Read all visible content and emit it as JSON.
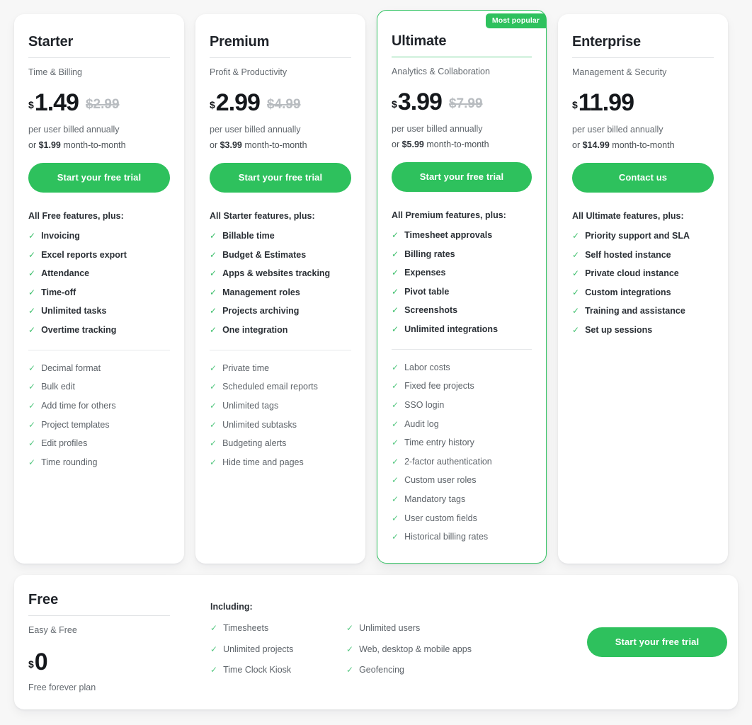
{
  "theme": {
    "accent": "#2ec15d",
    "tick": "#3cbf6b",
    "page_bg": "#f7f7f7",
    "card_bg": "#ffffff"
  },
  "plans": [
    {
      "name": "Starter",
      "tagline": "Time & Billing",
      "currency": "$",
      "price": "1.49",
      "old_price": "$2.99",
      "billing_note": "per user billed annually",
      "monthly_prefix": "or ",
      "monthly_price": "$1.99",
      "monthly_suffix": " month-to-month",
      "cta": "Start your free trial",
      "features_head": "All Free features, plus:",
      "primary_features": [
        "Invoicing",
        "Excel reports export",
        "Attendance",
        "Time-off",
        "Unlimited tasks",
        "Overtime tracking"
      ],
      "secondary_features": [
        "Decimal format",
        "Bulk edit",
        "Add time for others",
        "Project templates",
        "Edit profiles",
        "Time rounding"
      ]
    },
    {
      "name": "Premium",
      "tagline": "Profit & Productivity",
      "currency": "$",
      "price": "2.99",
      "old_price": "$4.99",
      "billing_note": "per user billed annually",
      "monthly_prefix": "or ",
      "monthly_price": "$3.99",
      "monthly_suffix": " month-to-month",
      "cta": "Start your free trial",
      "features_head": "All Starter features, plus:",
      "primary_features": [
        "Billable time",
        "Budget & Estimates",
        "Apps & websites tracking",
        "Management roles",
        "Projects archiving",
        "One integration"
      ],
      "secondary_features": [
        "Private time",
        "Scheduled email reports",
        "Unlimited tags",
        "Unlimited subtasks",
        "Budgeting alerts",
        "Hide time and pages"
      ]
    },
    {
      "name": "Ultimate",
      "badge": "Most popular",
      "tagline": "Analytics & Collaboration",
      "currency": "$",
      "price": "3.99",
      "old_price": "$7.99",
      "billing_note": "per user billed annually",
      "monthly_prefix": "or ",
      "monthly_price": "$5.99",
      "monthly_suffix": " month-to-month",
      "cta": "Start your free trial",
      "features_head": "All Premium features, plus:",
      "primary_features": [
        "Timesheet approvals",
        "Billing rates",
        "Expenses",
        "Pivot table",
        "Screenshots",
        "Unlimited integrations"
      ],
      "secondary_features": [
        "Labor costs",
        "Fixed fee projects",
        "SSO login",
        "Audit log",
        "Time entry history",
        "2-factor authentication",
        "Custom user roles",
        "Mandatory tags",
        "User custom fields",
        "Historical billing rates"
      ]
    },
    {
      "name": "Enterprise",
      "tagline": "Management & Security",
      "currency": "$",
      "price": "11.99",
      "old_price": "",
      "billing_note": "per user billed annually",
      "monthly_prefix": "or ",
      "monthly_price": "$14.99",
      "monthly_suffix": " month-to-month",
      "cta": "Contact us",
      "features_head": "All Ultimate features, plus:",
      "primary_features": [
        "Priority support and SLA",
        "Self hosted instance",
        "Private cloud instance",
        "Custom integrations",
        "Training and assistance",
        "Set up sessions"
      ],
      "secondary_features": []
    }
  ],
  "free_plan": {
    "name": "Free",
    "tagline": "Easy & Free",
    "currency": "$",
    "price": "0",
    "note": "Free forever plan",
    "including_head": "Including:",
    "features_col1": [
      "Timesheets",
      "Unlimited projects",
      "Time Clock Kiosk"
    ],
    "features_col2": [
      "Unlimited users",
      "Web, desktop & mobile apps",
      "Geofencing"
    ],
    "cta": "Start your free trial"
  },
  "icons": {
    "check": "✓"
  }
}
